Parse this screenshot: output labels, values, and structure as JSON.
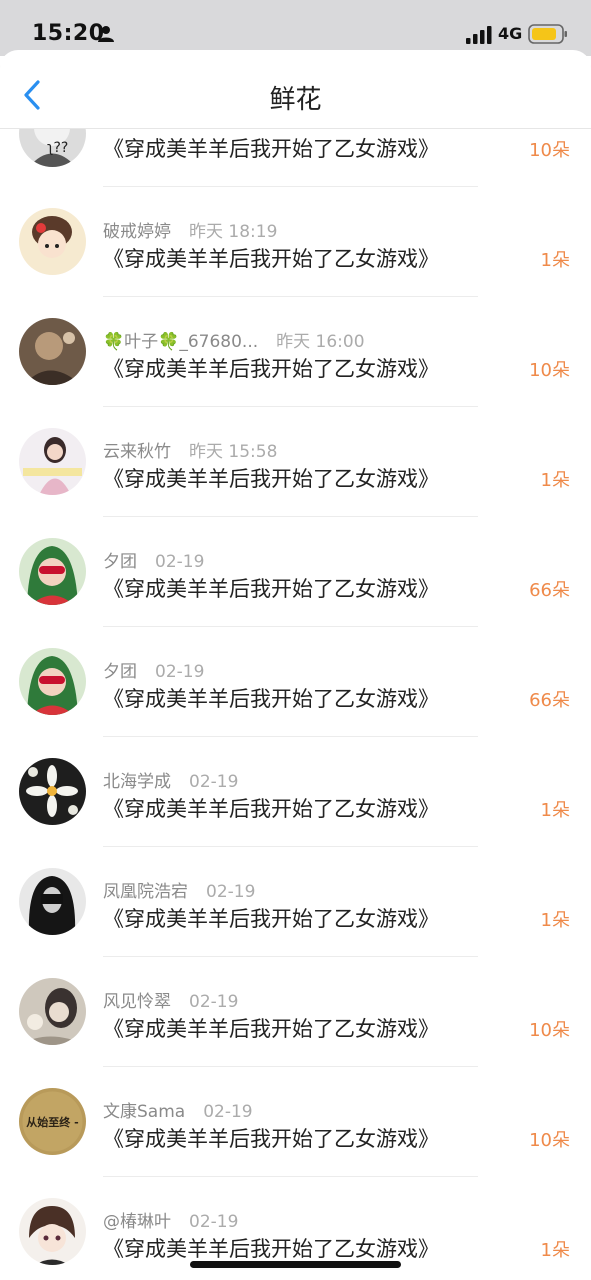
{
  "status_bar": {
    "time": "15:20",
    "network": "4G"
  },
  "nav": {
    "title": "鲜花",
    "back_icon": "chevron-left-icon"
  },
  "colors": {
    "accent": "#2a8ff0",
    "count": "#ef8a4a"
  },
  "rows": [
    {
      "name": "",
      "time": "",
      "book": "《穿成美羊羊后我开始了乙女游戏》",
      "count": "10朵"
    },
    {
      "name": "破戒婷婷",
      "time": "昨天 18:19",
      "book": "《穿成美羊羊后我开始了乙女游戏》",
      "count": "1朵"
    },
    {
      "name": "🍀叶子🍀_67680...",
      "time": "昨天 16:00",
      "book": "《穿成美羊羊后我开始了乙女游戏》",
      "count": "10朵"
    },
    {
      "name": "云来秋竹",
      "time": "昨天 15:58",
      "book": "《穿成美羊羊后我开始了乙女游戏》",
      "count": "1朵"
    },
    {
      "name": "夕团",
      "time": "02-19",
      "book": "《穿成美羊羊后我开始了乙女游戏》",
      "count": "66朵"
    },
    {
      "name": "夕团",
      "time": "02-19",
      "book": "《穿成美羊羊后我开始了乙女游戏》",
      "count": "66朵"
    },
    {
      "name": "北海学成",
      "time": "02-19",
      "book": "《穿成美羊羊后我开始了乙女游戏》",
      "count": "1朵"
    },
    {
      "name": "凤凰院浩宕",
      "time": "02-19",
      "book": "《穿成美羊羊后我开始了乙女游戏》",
      "count": "1朵"
    },
    {
      "name": "风见怜翠",
      "time": "02-19",
      "book": "《穿成美羊羊后我开始了乙女游戏》",
      "count": "10朵"
    },
    {
      "name": "文康Sama",
      "time": "02-19",
      "book": "《穿成美羊羊后我开始了乙女游戏》",
      "count": "10朵",
      "avatar_text": "从始至终 -"
    },
    {
      "name": "@椿琳叶",
      "time": "02-19",
      "book": "《穿成美羊羊后我开始了乙女游戏》",
      "count": "1朵"
    }
  ]
}
